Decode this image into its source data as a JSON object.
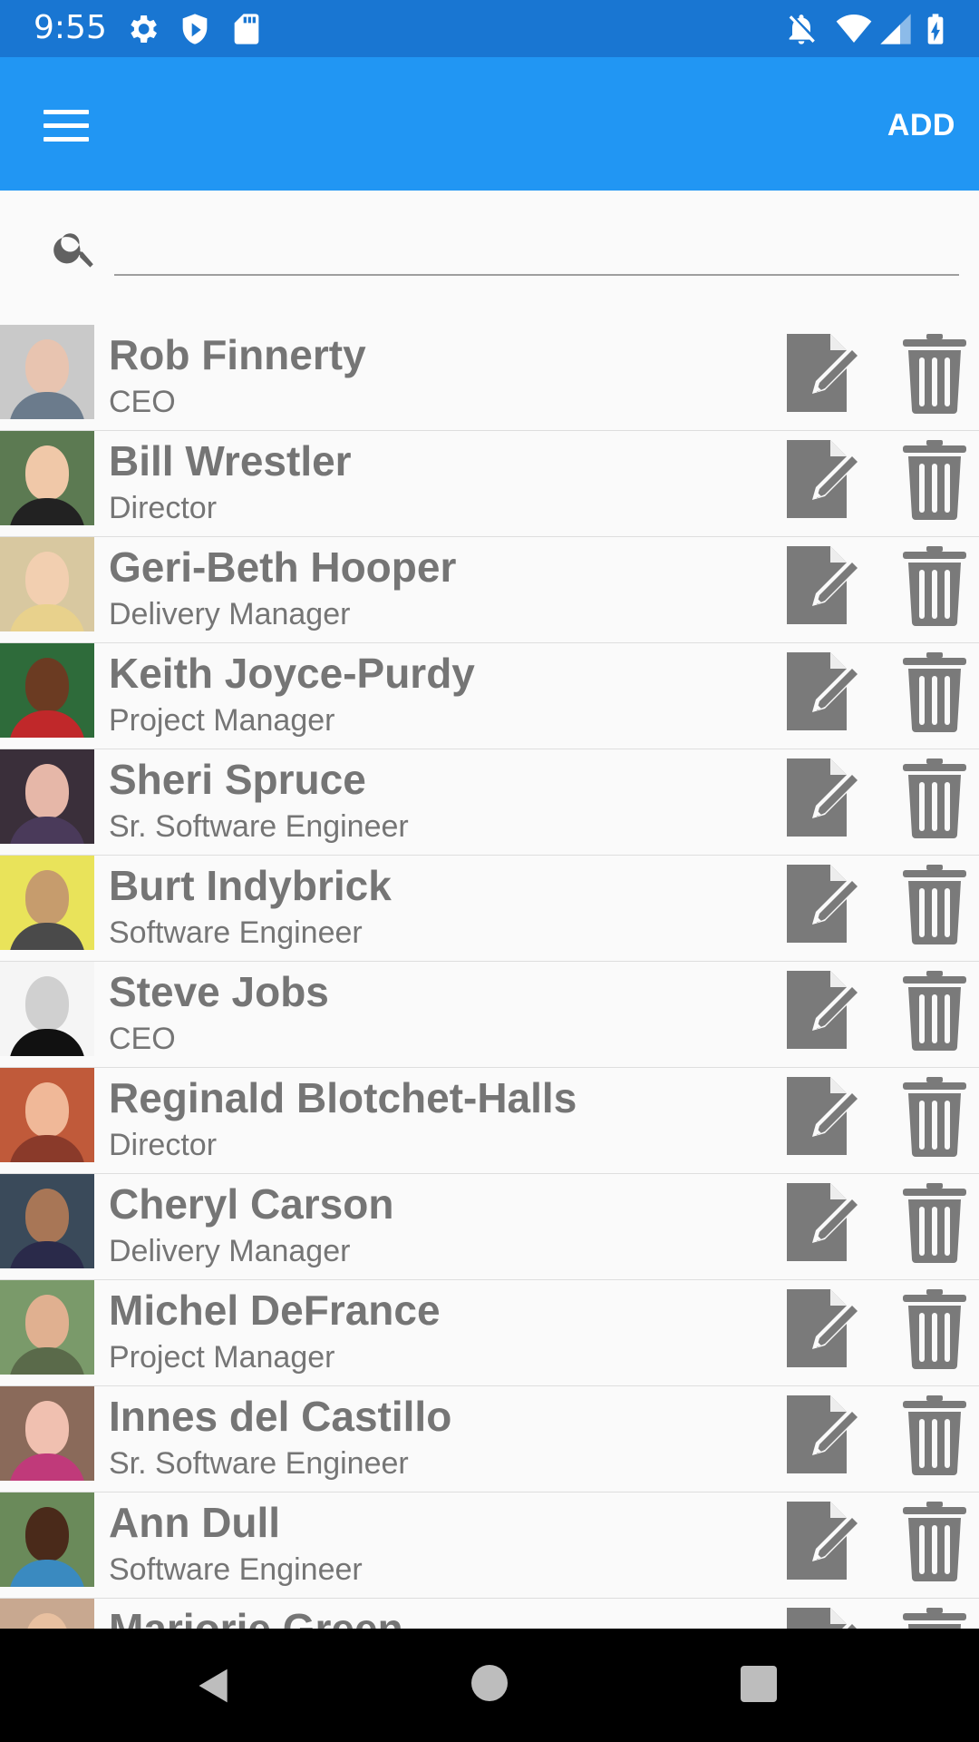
{
  "status_bar": {
    "time": "9:55",
    "left_icons": [
      "gear-icon",
      "shield-icon",
      "sd-card-icon"
    ],
    "right_icons": [
      "notifications-off-icon",
      "wifi-icon",
      "signal-icon",
      "battery-charging-icon"
    ]
  },
  "app_bar": {
    "menu_icon": "hamburger-menu-icon",
    "add_label": "ADD",
    "background": "#2196f3",
    "status_background": "#1976d2"
  },
  "search": {
    "icon": "search-icon",
    "value": "",
    "placeholder": ""
  },
  "contacts": [
    {
      "name": "Rob Finnerty",
      "title": "CEO",
      "skin": "#e8c4b0",
      "bg": "#c9c9c9",
      "shirt": "#6b7b8c"
    },
    {
      "name": "Bill Wrestler",
      "title": "Director",
      "skin": "#f0c8a8",
      "bg": "#5c7a52",
      "shirt": "#222222"
    },
    {
      "name": "Geri-Beth Hooper",
      "title": "Delivery Manager",
      "skin": "#f2cfb0",
      "bg": "#d8c8a0",
      "shirt": "#e8d18c"
    },
    {
      "name": "Keith Joyce-Purdy",
      "title": "Project Manager",
      "skin": "#6b3b22",
      "bg": "#2e6b3a",
      "shirt": "#c0282a"
    },
    {
      "name": "Sheri Spruce",
      "title": "Sr. Software Engineer",
      "skin": "#e6b7a8",
      "bg": "#3a2f3a",
      "shirt": "#4a3a5a"
    },
    {
      "name": "Burt Indybrick",
      "title": "Software Engineer",
      "skin": "#c69c6d",
      "bg": "#e9e35a",
      "shirt": "#4a4a4a"
    },
    {
      "name": "Steve Jobs",
      "title": "CEO",
      "skin": "#d0d0d0",
      "bg": "#f5f5f5",
      "shirt": "#111111"
    },
    {
      "name": "Reginald Blotchet-Halls",
      "title": "Director",
      "skin": "#f0b898",
      "bg": "#c05a3a",
      "shirt": "#8a3a2a"
    },
    {
      "name": "Cheryl Carson",
      "title": "Delivery Manager",
      "skin": "#a87656",
      "bg": "#3a4a5a",
      "shirt": "#2a2a4a"
    },
    {
      "name": "Michel DeFrance",
      "title": "Project Manager",
      "skin": "#e0b090",
      "bg": "#7a9a6a",
      "shirt": "#5a6a4a"
    },
    {
      "name": "Innes del Castillo",
      "title": "Sr. Software Engineer",
      "skin": "#f0c0b0",
      "bg": "#8a6a5a",
      "shirt": "#c03a7a"
    },
    {
      "name": "Ann Dull",
      "title": "Software Engineer",
      "skin": "#4a2a1a",
      "bg": "#6a8a5a",
      "shirt": "#3a8ac0"
    },
    {
      "name": "Marjorie Green",
      "title": "",
      "skin": "#e8c0a0",
      "bg": "#c8a890",
      "shirt": "#888888"
    }
  ],
  "row_actions": {
    "edit_icon": "edit-note-icon",
    "delete_icon": "trash-icon",
    "icon_color": "#7a7a7a"
  },
  "nav_bar": {
    "back_icon": "back-triangle-icon",
    "home_icon": "home-circle-icon",
    "recents_icon": "recents-square-icon"
  }
}
